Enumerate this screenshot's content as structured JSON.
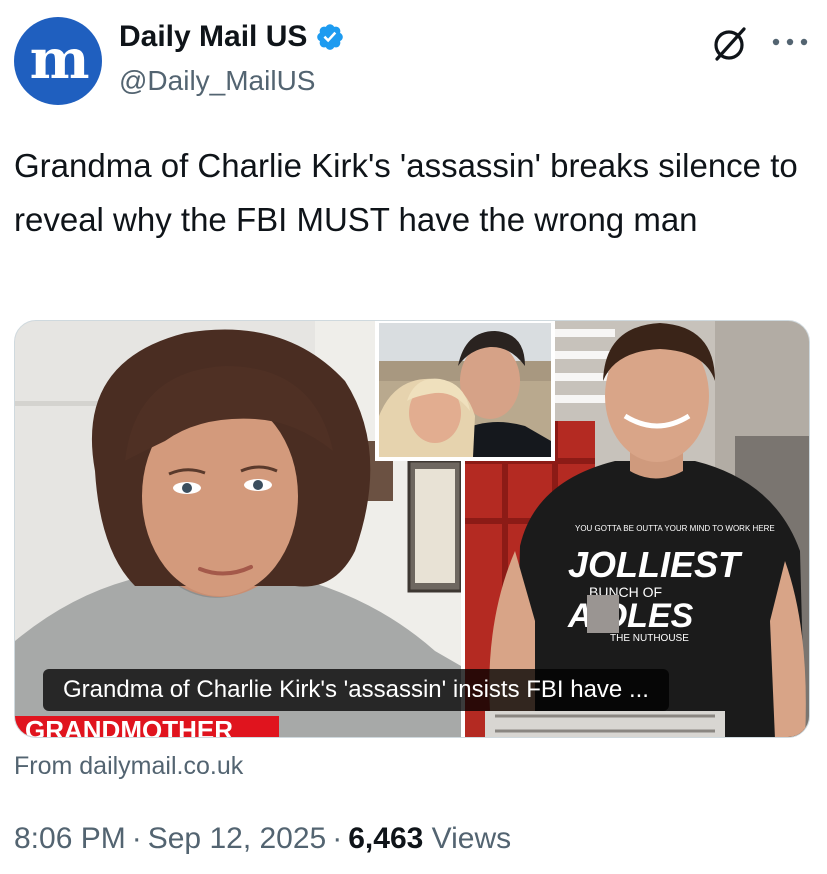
{
  "author": {
    "display_name": "Daily Mail US",
    "handle": "@Daily_MailUS",
    "avatar_glyph": "m",
    "avatar_color": "#1f5fbf",
    "verified_color": "#1d9bf0",
    "verified_icon": "verified-badge-icon"
  },
  "actions": {
    "grok_icon": "grok-icon",
    "more_icon": "more-icon"
  },
  "tweet": {
    "text": "Grandma of Charlie Kirk's 'assassin' breaks silence to reveal why the FBI MUST have the wrong man"
  },
  "card": {
    "caption": "Grandma of Charlie Kirk's 'assassin' insists FBI have ...",
    "source": "From dailymail.co.uk",
    "shirt_line1": "JOLLIEST",
    "shirt_line2": "BUNCH OF",
    "shirt_line3": "A    OLES",
    "shirt_line4": "THE NUTHOUSE",
    "banner_text": "GRANDMOTHER"
  },
  "meta": {
    "time": "8:06 PM",
    "separator": "·",
    "date": "Sep 12, 2025",
    "views_count": "6,463",
    "views_label": "Views"
  }
}
